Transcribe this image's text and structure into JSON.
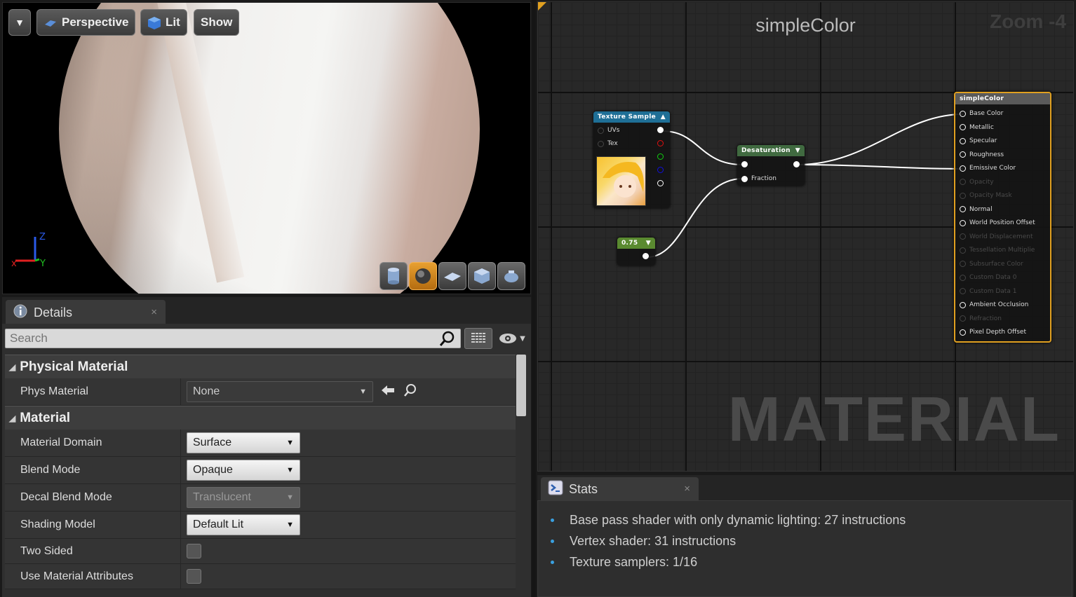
{
  "viewport": {
    "buttons": {
      "menu": "▾",
      "perspective": "Perspective",
      "lit": "Lit",
      "show": "Show"
    },
    "axis_labels": {
      "z": "Z",
      "y": "Y",
      "x": "x"
    }
  },
  "details": {
    "tab_label": "Details",
    "close": "×",
    "search": {
      "placeholder": "Search",
      "value": ""
    },
    "categories": [
      {
        "label": "Physical Material",
        "rows": [
          {
            "label": "Phys Material",
            "value": "None"
          }
        ]
      },
      {
        "label": "Material",
        "rows": [
          {
            "label": "Material Domain",
            "value": "Surface"
          },
          {
            "label": "Blend Mode",
            "value": "Opaque"
          },
          {
            "label": "Decal Blend Mode",
            "value": "Translucent"
          },
          {
            "label": "Shading Model",
            "value": "Default Lit"
          },
          {
            "label": "Two Sided",
            "value": ""
          },
          {
            "label": "Use Material Attributes",
            "value": ""
          }
        ]
      }
    ]
  },
  "graph": {
    "title": "simpleColor",
    "zoom": "Zoom -4",
    "watermark": "MATERIAL",
    "texture_node": {
      "title": "Texture Sample",
      "pins": [
        "UVs",
        "Tex"
      ]
    },
    "desat_node": {
      "title": "Desaturation",
      "pins": [
        "Fraction"
      ]
    },
    "const_node": {
      "value": "0.75"
    },
    "result_node": {
      "title": "simpleColor",
      "pins": [
        {
          "label": "Base Color",
          "active": true
        },
        {
          "label": "Metallic",
          "active": true
        },
        {
          "label": "Specular",
          "active": true
        },
        {
          "label": "Roughness",
          "active": true
        },
        {
          "label": "Emissive Color",
          "active": true
        },
        {
          "label": "Opacity",
          "active": false
        },
        {
          "label": "Opacity Mask",
          "active": false
        },
        {
          "label": "Normal",
          "active": true
        },
        {
          "label": "World Position Offset",
          "active": true
        },
        {
          "label": "World Displacement",
          "active": false
        },
        {
          "label": "Tessellation Multiplie",
          "active": false
        },
        {
          "label": "Subsurface Color",
          "active": false
        },
        {
          "label": "Custom Data 0",
          "active": false
        },
        {
          "label": "Custom Data 1",
          "active": false
        },
        {
          "label": "Ambient Occlusion",
          "active": true
        },
        {
          "label": "Refraction",
          "active": false
        },
        {
          "label": "Pixel Depth Offset",
          "active": true
        }
      ]
    }
  },
  "stats": {
    "tab_label": "Stats",
    "close": "×",
    "items": [
      "Base pass shader with only dynamic lighting: 27 instructions",
      "Vertex shader: 31 instructions",
      "Texture samplers: 1/16"
    ]
  },
  "colors": {
    "accent": "#e8a030",
    "texture_header": "#1f6f96",
    "desat_header": "#406a40",
    "const_header": "#5a8a30",
    "result_border": "#e0a020"
  },
  "icons": [
    "chevron-down-icon",
    "sphere-icon",
    "cube-lit-icon",
    "details-info-icon",
    "search-icon",
    "grid-icon",
    "eye-icon",
    "back-arrow-icon",
    "browse-icon",
    "stats-icon"
  ]
}
